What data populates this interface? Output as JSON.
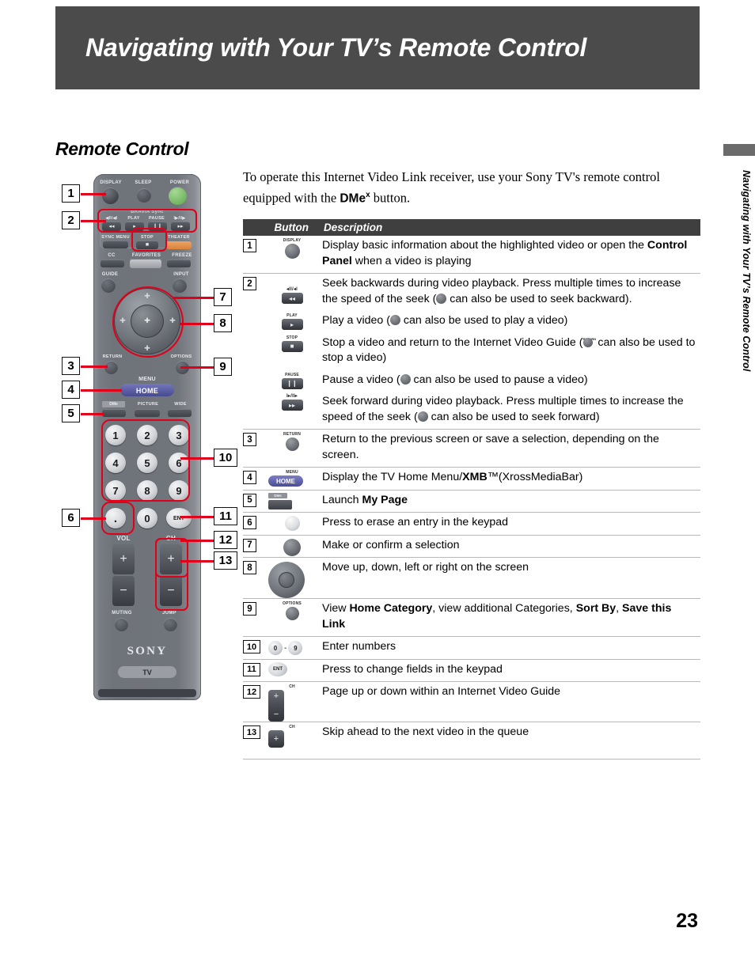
{
  "header": {
    "title": "Navigating with Your TV’s Remote Control"
  },
  "section": {
    "heading": "Remote Control"
  },
  "intro": {
    "line_a": "To operate this Internet Video Link receiver, use your Sony TV's remote control equipped with the ",
    "bold": "DMe",
    "sup": "x",
    "line_b": " button."
  },
  "side_tab": {
    "text": "Navigating with Your TV’s Remote Control"
  },
  "page_number": "23",
  "table": {
    "headers": {
      "button": "Button",
      "description": "Description"
    },
    "rows": [
      {
        "num": "1",
        "icon": "display-button-icon",
        "icon_caption": "DISPLAY",
        "desc_html": "Display basic information about the highlighted video or open the <b>Control Panel</b> when a video is playing"
      },
      {
        "num": "2",
        "icon": "rewind-button-icon",
        "icon_caption": "◀◀",
        "desc_html": "Seek backwards during video playback. Press multiple times to increase the speed of the seek (✦ can also be used to seek backward)."
      },
      {
        "num": "",
        "icon": "play-button-icon",
        "icon_caption": "PLAY",
        "desc_html": "Play a video (✦ can also be used to play a video)"
      },
      {
        "num": "",
        "icon": "stop-button-icon",
        "icon_caption": "STOP",
        "desc_html": "Stop a video and return to the Internet Video Guide (✦ can also be used to stop a video)"
      },
      {
        "num": "",
        "icon": "pause-button-icon",
        "icon_caption": "PAUSE",
        "desc_html": "Pause a video (✦ can also be used to pause a video)"
      },
      {
        "num": "",
        "icon": "fast-forward-button-icon",
        "icon_caption": "▶▶",
        "desc_html": "Seek forward during video playback. Press multiple times to increase the speed of the seek (✦ can also be used to seek forward)"
      },
      {
        "num": "3",
        "icon": "return-button-icon",
        "icon_caption": "RETURN",
        "desc_html": "Return to the previous screen or save a selection, depending on the screen."
      },
      {
        "num": "4",
        "icon": "home-menu-button-icon",
        "icon_caption": "MENU",
        "icon_label": "HOME",
        "desc_html": "Display the TV Home Menu/<b>XMB</b>™(XrossMediaBar)"
      },
      {
        "num": "5",
        "icon": "dme-button-icon",
        "icon_caption": "DMe",
        "desc_html": "Launch <b>My Page</b>"
      },
      {
        "num": "6",
        "icon": "dot-erase-button-icon",
        "icon_caption": "",
        "desc_html": "Press to erase an entry in the keypad"
      },
      {
        "num": "7",
        "icon": "center-select-button-icon",
        "icon_caption": "",
        "desc_html": "Make or confirm a selection"
      },
      {
        "num": "8",
        "icon": "directional-pad-icon",
        "icon_caption": "",
        "desc_html": "Move up, down, left or right on the screen"
      },
      {
        "num": "9",
        "icon": "options-button-icon",
        "icon_caption": "OPTIONS",
        "desc_html": "View <b>Home Category</b>, view additional Categories, <b>Sort By</b>, <b>Save this Link</b>"
      },
      {
        "num": "10",
        "icon": "number-keys-icon",
        "icon_caption": "",
        "icon_from": "0",
        "icon_to": "9",
        "desc_html": "Enter numbers"
      },
      {
        "num": "11",
        "icon": "ent-button-icon",
        "icon_caption": "",
        "icon_label": "ENT",
        "desc_html": "Press to change fields in the keypad"
      },
      {
        "num": "12",
        "icon": "channel-rocker-icon",
        "icon_caption": "CH",
        "desc_html": "Page up or down within an Internet Video Guide"
      },
      {
        "num": "13",
        "icon": "channel-up-button-icon",
        "icon_caption": "CH",
        "desc_html": "Skip ahead to the next video in the queue"
      }
    ]
  },
  "remote": {
    "top_labels": {
      "display": "DISPLAY",
      "sleep": "SLEEP",
      "power": "POWER"
    },
    "bravia": "BRAVIA Sync",
    "transport": {
      "rew_top": "◀ll/◀l",
      "play": "PLAY",
      "pause": "PAUSE",
      "ff_top": "l▶/ll▶"
    },
    "sync_row": {
      "sync_menu": "SYNC MENU",
      "stop": "STOP",
      "theater": "THEATER"
    },
    "cc_row": {
      "cc": "CC",
      "favorites": "FAVORITES",
      "freeze": "FREEZE"
    },
    "guide_row": {
      "guide": "GUIDE",
      "input": "INPUT"
    },
    "nav_row": {
      "return": "RETURN",
      "options": "OPTIONS"
    },
    "menu": {
      "menu": "MENU",
      "home": "HOME"
    },
    "dme_row": {
      "dme": "DMe",
      "picture": "PICTURE",
      "wide": "WIDE"
    },
    "keys": [
      "1",
      "2",
      "3",
      "4",
      "5",
      "6",
      "7",
      "8",
      "9",
      ".",
      "0",
      "ENT"
    ],
    "vol": {
      "label": "VOL",
      "plus": "+",
      "minus": "−"
    },
    "ch": {
      "label": "CH",
      "plus": "+",
      "minus": "−"
    },
    "bottom_row": {
      "muting": "MUTING",
      "jump": "JUMP"
    },
    "brand": "SONY",
    "tv_pill": "TV",
    "callouts": [
      "1",
      "2",
      "3",
      "4",
      "5",
      "6",
      "7",
      "8",
      "9",
      "10",
      "11",
      "12",
      "13"
    ]
  },
  "colors": {
    "header_bg": "#4b4b4b",
    "table_header_bg": "#3f3f3f",
    "callout_red": "#e1001a",
    "home_blue": "#5a5da0",
    "power_green": "#6fbf5c",
    "theater_orange": "#e8954a"
  }
}
